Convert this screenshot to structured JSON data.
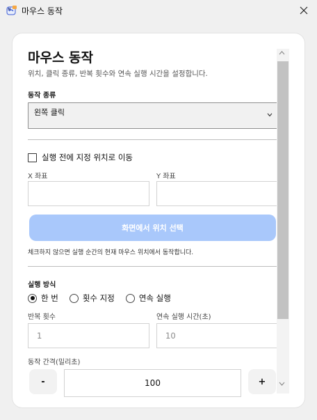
{
  "window": {
    "title": "마우스 동작",
    "app_icon": "mouse-app-icon",
    "close_icon": "close-icon"
  },
  "header": {
    "title": "마우스 동작",
    "subtitle": "위치, 클릭 종류, 반복 횟수와 연속 실행 시간을 설정합니다."
  },
  "action_type": {
    "label": "동작 종류",
    "selected": "왼쪽 클릭"
  },
  "move_option": {
    "label": "실행 전에 지정 위치로 이동",
    "checked": false
  },
  "coordinates": {
    "x_label": "X 좌표",
    "y_label": "Y 좌표",
    "x_value": "",
    "y_value": ""
  },
  "pick_button": {
    "label": "화면에서 위치 선택",
    "color": "#a9c8fb"
  },
  "hint": "체크하지 않으면 실행 순간의 현재 마우스 위치에서 동작합니다.",
  "run_mode": {
    "label": "실행 방식",
    "options": [
      "한 번",
      "횟수 지정",
      "연속 실행"
    ],
    "selected_index": 0
  },
  "repeat": {
    "count_label": "반복 횟수",
    "count_value": "1",
    "duration_label": "연속 실행 시간(초)",
    "duration_value": "10"
  },
  "interval": {
    "label": "동작 간격(밀리초)",
    "minus": "-",
    "value": "100",
    "plus": "+"
  },
  "scrollbar": {
    "up_icon": "chevron-up-icon",
    "down_icon": "chevron-down-icon"
  }
}
